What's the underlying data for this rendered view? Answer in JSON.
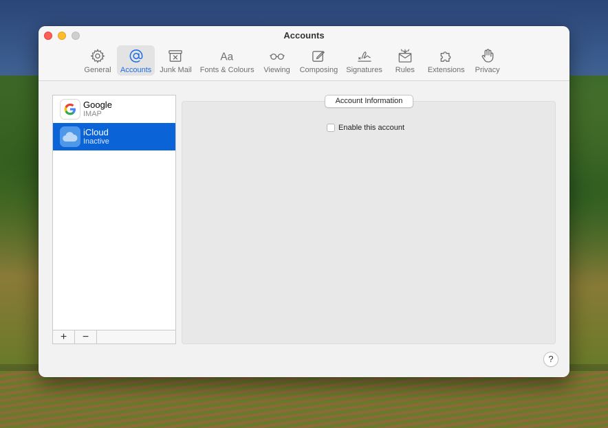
{
  "window": {
    "title": "Accounts"
  },
  "toolbar": {
    "items": [
      {
        "label": "General",
        "icon": "gear-icon"
      },
      {
        "label": "Accounts",
        "icon": "at-sign-icon",
        "active": true
      },
      {
        "label": "Junk Mail",
        "icon": "junk-tray-icon"
      },
      {
        "label": "Fonts & Colours",
        "icon": "font-aa-icon"
      },
      {
        "label": "Viewing",
        "icon": "glasses-icon"
      },
      {
        "label": "Composing",
        "icon": "compose-icon"
      },
      {
        "label": "Signatures",
        "icon": "signature-icon"
      },
      {
        "label": "Rules",
        "icon": "rules-envelope-icon"
      },
      {
        "label": "Extensions",
        "icon": "puzzle-icon"
      },
      {
        "label": "Privacy",
        "icon": "hand-icon"
      }
    ],
    "accent": "#1e6ee6"
  },
  "accounts": {
    "items": [
      {
        "name": "Google",
        "type": "IMAP",
        "selected": false
      },
      {
        "name": "iCloud",
        "type": "Inactive",
        "selected": true
      }
    ],
    "add_label": "+",
    "remove_label": "−",
    "selection_color": "#0b63d8"
  },
  "detail": {
    "tab_label": "Account Information",
    "enable_label": "Enable this account",
    "enable_checked": false
  },
  "help_label": "?"
}
